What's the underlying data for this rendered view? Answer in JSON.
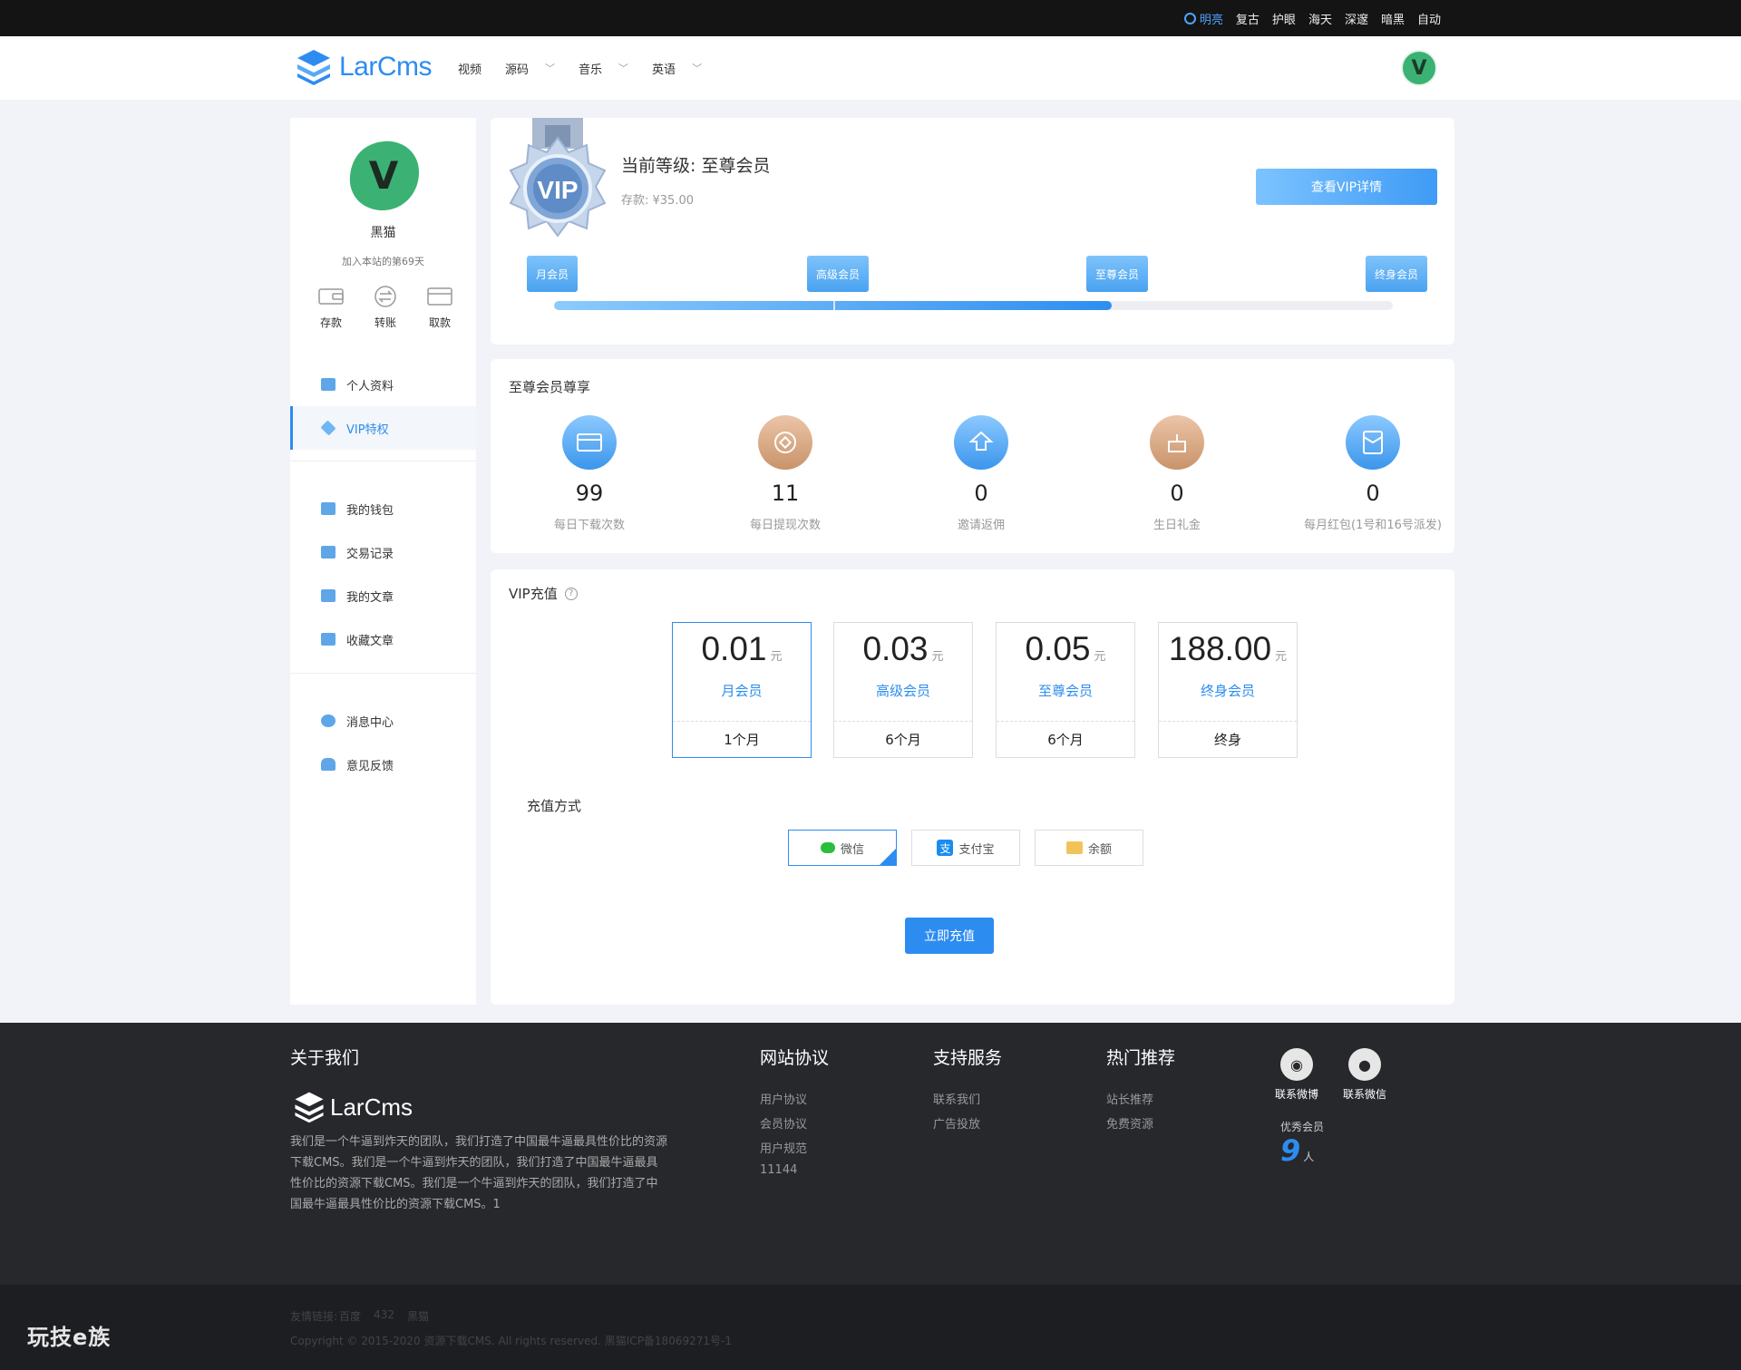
{
  "topbar": {
    "themes": [
      "明亮",
      "复古",
      "护眼",
      "海天",
      "深邃",
      "暗黑",
      "自动"
    ]
  },
  "header": {
    "logo_text": "LarCms",
    "nav": [
      {
        "label": "视频",
        "has_dropdown": false
      },
      {
        "label": "源码",
        "has_dropdown": true
      },
      {
        "label": "音乐",
        "has_dropdown": true
      },
      {
        "label": "英语",
        "has_dropdown": true
      }
    ],
    "avatar_letter": "V"
  },
  "sidebar": {
    "avatar_letter": "V",
    "username": "黑猫",
    "joined": "加入本站的第69天",
    "actions": [
      "存款",
      "转账",
      "取款"
    ],
    "menu_group1": [
      {
        "label": "个人资料",
        "icon": "id-card-icon"
      },
      {
        "label": "VIP特权",
        "icon": "diamond-icon",
        "active": true
      }
    ],
    "menu_group2": [
      {
        "label": "我的钱包",
        "icon": "wallet-icon"
      },
      {
        "label": "交易记录",
        "icon": "record-icon"
      },
      {
        "label": "我的文章",
        "icon": "article-icon"
      },
      {
        "label": "收藏文章",
        "icon": "favorite-icon"
      }
    ],
    "menu_group3": [
      {
        "label": "消息中心",
        "icon": "message-icon"
      },
      {
        "label": "意见反馈",
        "icon": "bell-icon"
      }
    ]
  },
  "level": {
    "badge_text": "VIP",
    "title": "当前等级: 至尊会员",
    "balance": "存款: ¥35.00",
    "detail_button": "查看VIP详情",
    "tiers": [
      "月会员",
      "高级会员",
      "至尊会员",
      "终身会员"
    ],
    "progress": 0.665
  },
  "perks": {
    "title": "至尊会员尊享",
    "items": [
      {
        "value": "99",
        "label": "每日下载次数",
        "icon": "download-card-icon",
        "color": "#4aa3ef"
      },
      {
        "value": "11",
        "label": "每日提现次数",
        "icon": "coin-icon",
        "color": "#d2a07c"
      },
      {
        "value": "0",
        "label": "邀请返佣",
        "icon": "upload-house-icon",
        "color": "#4aa3ef"
      },
      {
        "value": "0",
        "label": "生日礼金",
        "icon": "cake-icon",
        "color": "#d2a07c"
      },
      {
        "value": "0",
        "label": "每月红包(1号和16号派发)",
        "icon": "red-envelope-icon",
        "color": "#4aa3ef"
      }
    ]
  },
  "recharge": {
    "title": "VIP充值",
    "currency_unit": "元",
    "plans": [
      {
        "price": "0.01",
        "name": "月会员",
        "duration": "1个月",
        "selected": true
      },
      {
        "price": "0.03",
        "name": "高级会员",
        "duration": "6个月",
        "selected": false
      },
      {
        "price": "0.05",
        "name": "至尊会员",
        "duration": "6个月",
        "selected": false
      },
      {
        "price": "188.00",
        "name": "终身会员",
        "duration": "终身",
        "selected": false
      }
    ],
    "pay_label": "充值方式",
    "pay_methods": [
      {
        "label": "微信",
        "icon": "wechat-icon",
        "selected": true
      },
      {
        "label": "支付宝",
        "icon": "alipay-icon",
        "selected": false
      },
      {
        "label": "余额",
        "icon": "wallet-icon",
        "selected": false
      }
    ],
    "submit": "立即充值"
  },
  "footer": {
    "about_title": "关于我们",
    "logo_text": "LarCms",
    "about_text": "我们是一个牛逼到炸天的团队，我们打造了中国最牛逼最具性价比的资源下载CMS。我们是一个牛逼到炸天的团队，我们打造了中国最牛逼最具性价比的资源下载CMS。我们是一个牛逼到炸天的团队，我们打造了中国最牛逼最具性价比的资源下载CMS。1",
    "col2_title": "网站协议",
    "col2_links": [
      "用户协议",
      "会员协议",
      "用户规范",
      "11144"
    ],
    "col3_title": "支持服务",
    "col3_links": [
      "联系我们",
      "广告投放"
    ],
    "col4_title": "热门推荐",
    "col4_links": [
      "站长推荐",
      "免费资源"
    ],
    "social": [
      {
        "label": "联系微博",
        "icon": "weibo-icon"
      },
      {
        "label": "联系微信",
        "icon": "wechat-icon"
      }
    ],
    "members_label": "优秀会员",
    "members_count": "9",
    "members_unit": "人"
  },
  "bottom": {
    "friend_links_label": "友情链接:",
    "friend_links": [
      "百度",
      "432",
      "黑猫"
    ],
    "copyright": "Copyright © 2015-2020 资源下载CMS. All rights reserved. 黑猫ICP备18069271号-1",
    "brand": "玩技e族"
  }
}
